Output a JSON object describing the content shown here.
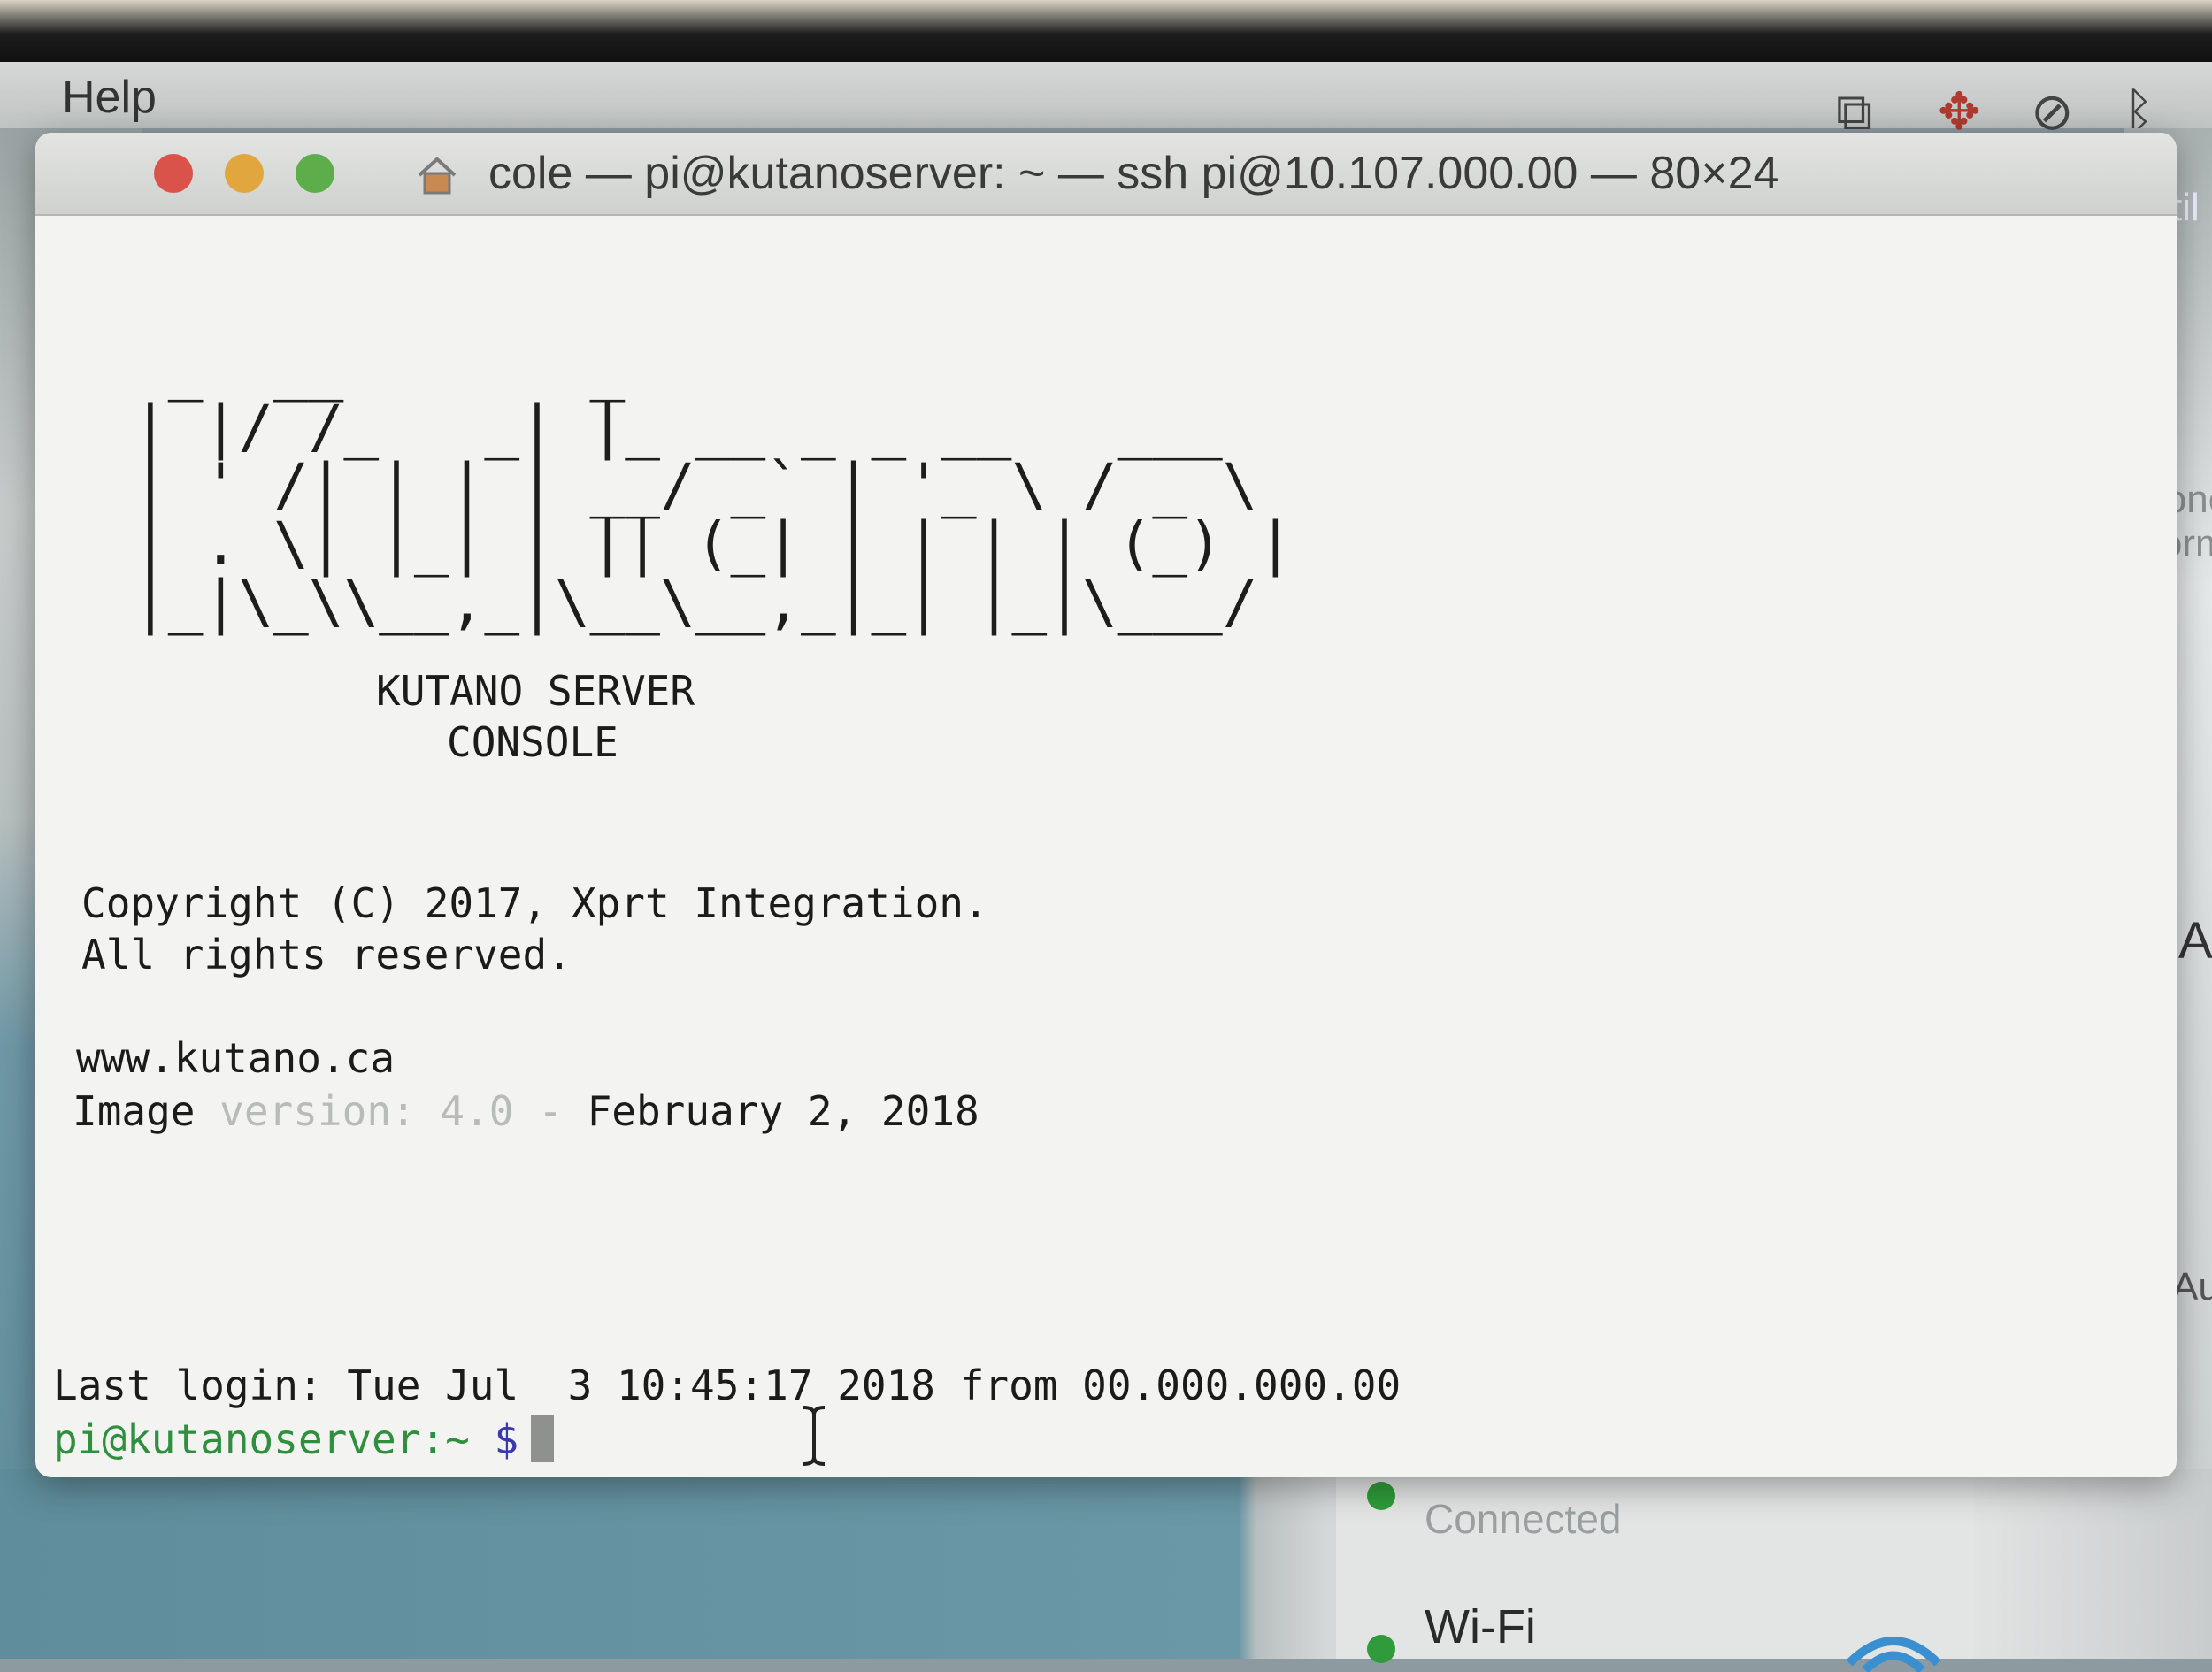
{
  "menubar": {
    "help_label": "Help",
    "tray_icons": [
      "screen-mirroring-icon",
      "app-status-icon",
      "time-machine-icon",
      "bluetooth-icon"
    ]
  },
  "background": {
    "right_app_fragments": [
      "patil",
      "Conc",
      "Form",
      "A",
      "Au"
    ],
    "network_panel": {
      "status": "Connected",
      "wifi_label": "Wi-Fi"
    }
  },
  "window": {
    "title": "cole — pi@kutanoserver: ~ — ssh pi@10.107.000.00 — 80×24",
    "buttons": [
      "close-button",
      "minimize-button",
      "zoom-button"
    ]
  },
  "terminal": {
    "ascii_logo": " _  __       _\n| |/ /_   _| |_ __ _ _ __   ___\n| ' /| | | | __/ _` | '_ \\ / _ \\\n| . \\| |_| | || (_| | | | | (_) |\n|_|\\_\\\\__,_|\\__\\__,_|_| |_|\\___/",
    "banner_line_1": "KUTANO SERVER",
    "banner_line_2": "CONSOLE",
    "copyright_line_1": "Copyright (C) 2017, Xprt Integration.",
    "copyright_line_2": "All rights reserved.",
    "website": "www.kutano.ca",
    "image_version_label": "Image ",
    "image_version_faded": "version: 4.0 - ",
    "image_version_date": "February 2, 2018",
    "last_login": "Last login: Tue Jul  3 10:45:17 2018 from 00.000.000.00",
    "prompt": "pi@kutanoserver:~",
    "prompt_symbol": "$"
  },
  "colors": {
    "prompt_green": "#2f8f3e",
    "prompt_symbol_blue": "#3a3ab0",
    "close_red": "#d9534a",
    "minimize_amber": "#e2a63e",
    "zoom_green": "#5dae4a"
  }
}
